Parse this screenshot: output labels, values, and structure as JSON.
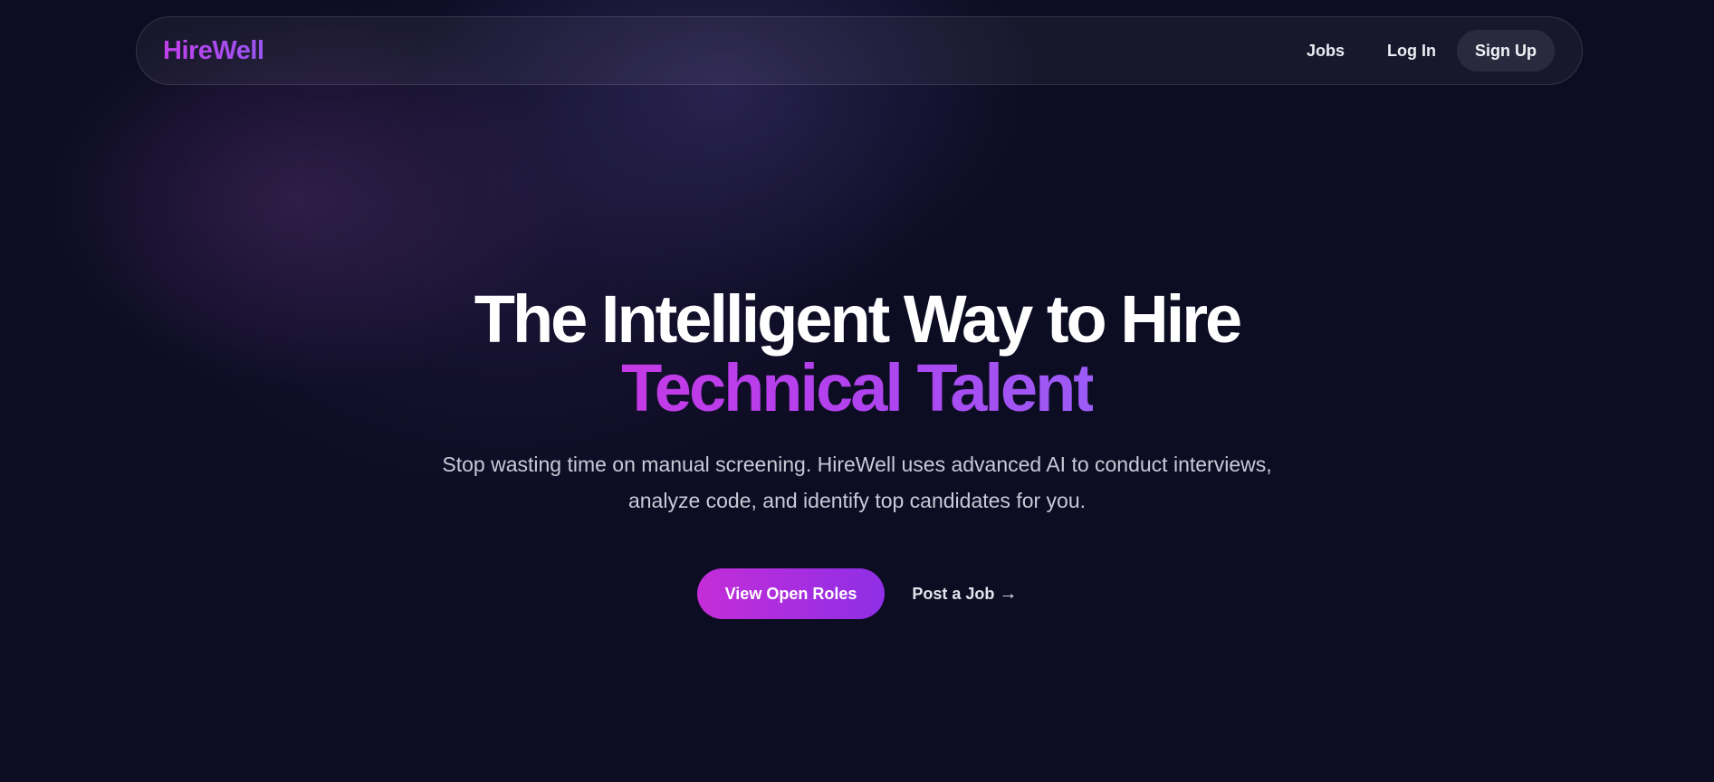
{
  "nav": {
    "brand": "HireWell",
    "links": [
      "Jobs",
      "Log In"
    ],
    "signup_label": "Sign Up"
  },
  "hero": {
    "title_line1": "The Intelligent Way to Hire",
    "title_line2": "Technical Talent",
    "subtitle": "Stop wasting time on manual screening. HireWell uses advanced AI to conduct interviews, analyze code, and identify top candidates for you.",
    "primary_cta": "View Open Roles",
    "secondary_cta": "Post a Job",
    "secondary_cta_icon": "arrow-right-icon",
    "arrow_glyph": "→"
  },
  "colors": {
    "background": "#0c0c22",
    "brand_gradient_start": "#c040e8",
    "brand_gradient_end": "#9a55f5",
    "button_gradient_start": "#c42dd8",
    "button_gradient_end": "#8e2fe6"
  }
}
